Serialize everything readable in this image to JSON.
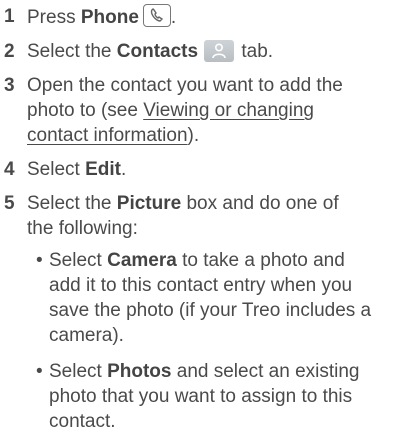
{
  "steps": [
    {
      "num": "1",
      "pre": "Press ",
      "bold": "Phone",
      "post": "."
    },
    {
      "num": "2",
      "pre": "Select the ",
      "bold": "Contacts",
      "post": " tab."
    },
    {
      "num": "3",
      "line1": "Open the contact you want to add the",
      "line2_pre": "photo to (see ",
      "link_a": "Viewing or changing",
      "link_b": "contact information",
      "line3_post": ")."
    },
    {
      "num": "4",
      "pre": "Select ",
      "bold": "Edit",
      "post": "."
    },
    {
      "num": "5",
      "pre": "Select the ",
      "bold": "Picture",
      "post": " box and do one of",
      "line2": "the following:"
    }
  ],
  "bullets": [
    {
      "pre": "Select ",
      "bold": "Camera",
      "l1_post": " to take a photo and",
      "l2": "add it to this contact entry when you",
      "l3": "save the photo (if your Treo includes a",
      "l4": "camera)."
    },
    {
      "pre": "Select ",
      "bold": "Photos",
      "l1_post": " and select an existing",
      "l2": "photo that you want to assign to this",
      "l3": "contact."
    }
  ],
  "icons": {
    "phone": "phone-handset-icon",
    "contacts": "contacts-person-icon"
  }
}
